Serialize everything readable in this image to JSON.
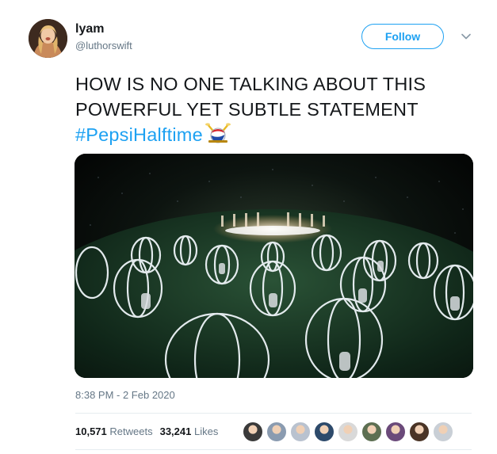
{
  "user": {
    "name": "lyam",
    "handle": "@luthorswift"
  },
  "follow_button": {
    "label": "Follow"
  },
  "tweet": {
    "line1": "HOW IS NO ONE TALKING ABOUT THIS",
    "line2": "POWERFUL YET SUBTLE STATEMENT",
    "hashtag": "#PepsiHalftime"
  },
  "timestamp": "8:38 PM - 2 Feb 2020",
  "stats": {
    "retweets_count": "10,571",
    "retweets_label": "Retweets",
    "likes_count": "33,241",
    "likes_label": "Likes"
  },
  "likers": [
    {
      "color": "#3a3a3a"
    },
    {
      "color": "#8a9bb0"
    },
    {
      "color": "#b9c2cf"
    },
    {
      "color": "#2d4a6b"
    },
    {
      "color": "#d9d9d9"
    },
    {
      "color": "#5d6f52"
    },
    {
      "color": "#6b4a7a"
    },
    {
      "color": "#4a3426"
    },
    {
      "color": "#c9cfd6"
    }
  ],
  "icons": {
    "caret": "chevron-down-icon",
    "emoji": "pepsi-drum-emoji"
  }
}
